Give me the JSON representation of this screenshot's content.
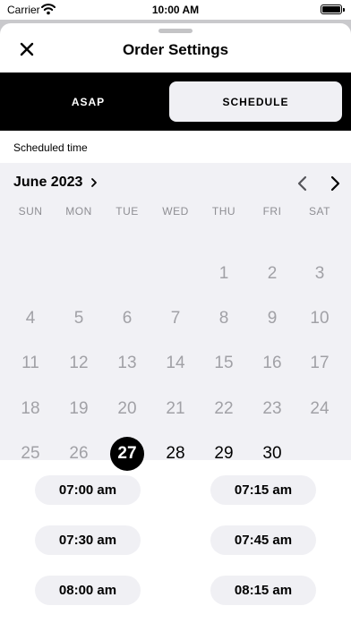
{
  "status_bar": {
    "carrier": "Carrier",
    "time": "10:00 AM"
  },
  "header": {
    "title": "Order Settings",
    "close_icon": "close-icon"
  },
  "mode_tabs": [
    {
      "label": "ASAP",
      "selected": false
    },
    {
      "label": "SCHEDULE",
      "selected": true
    }
  ],
  "section_label": "Scheduled time",
  "calendar": {
    "month": "June 2023",
    "weekdays": [
      "SUN",
      "MON",
      "TUE",
      "WED",
      "THU",
      "FRI",
      "SAT"
    ],
    "weeks": [
      [
        null,
        null,
        null,
        null,
        "1",
        "2",
        "3"
      ],
      [
        "4",
        "5",
        "6",
        "7",
        "8",
        "9",
        "10"
      ],
      [
        "11",
        "12",
        "13",
        "14",
        "15",
        "16",
        "17"
      ],
      [
        "18",
        "19",
        "20",
        "21",
        "22",
        "23",
        "24"
      ],
      [
        "25",
        "26",
        "27",
        "28",
        "29",
        "30",
        null
      ]
    ],
    "selected_day": "27",
    "available_days": [
      "28",
      "29",
      "30"
    ]
  },
  "time_slots": [
    "07:00 am",
    "07:15 am",
    "07:30 am",
    "07:45 am",
    "08:00 am",
    "08:15 am"
  ],
  "colors": {
    "accent": "#000000",
    "surface": "#f1f1f5",
    "disabled_day": "#a1a1a6"
  }
}
